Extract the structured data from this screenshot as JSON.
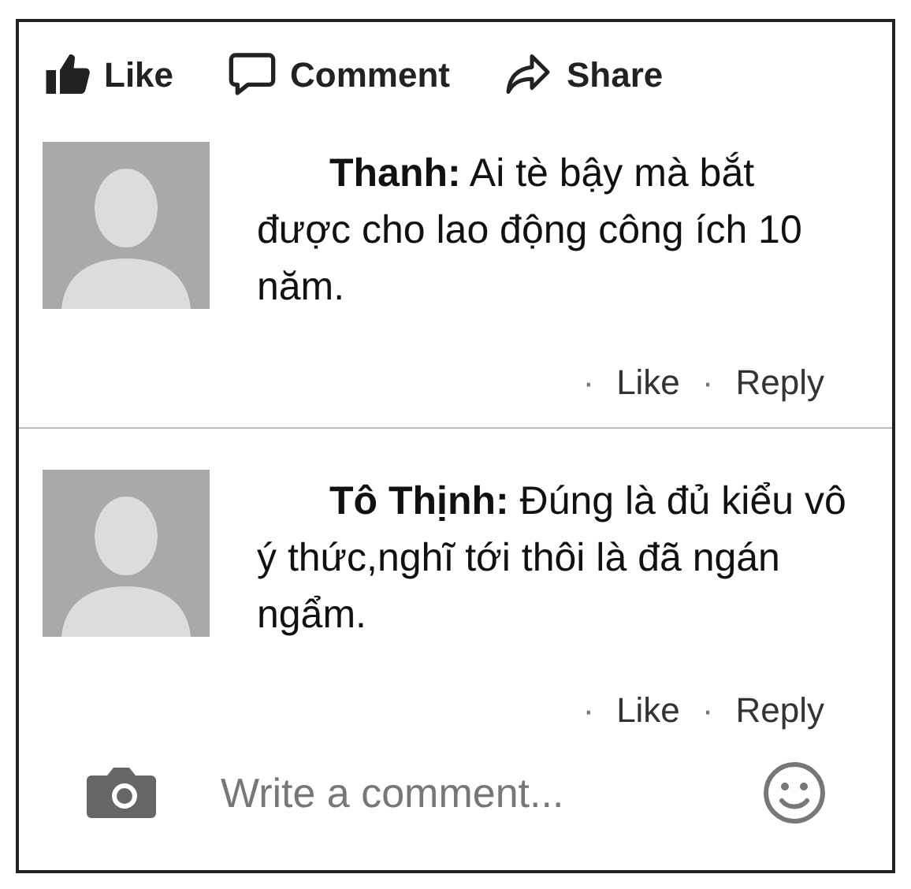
{
  "actions": [
    {
      "kind": "like",
      "label": "Like"
    },
    {
      "kind": "comment",
      "label": "Comment"
    },
    {
      "kind": "share",
      "label": "Share"
    }
  ],
  "comments": [
    {
      "text": "**Thanh:** Ai tè bậy mà bắt được cho lao động công ích 10 năm.",
      "actions": [
        {
          "bullet": "·",
          "label": "Like"
        },
        {
          "bullet": "·",
          "label": "Reply"
        }
      ]
    },
    {
      "text": "**Tô Thịnh:** Đúng là đủ kiểu vô ý thức,nghĩ tới thôi là đã ngán ngẩm.",
      "actions": [
        {
          "bullet": "·",
          "label": "Like"
        },
        {
          "bullet": "·",
          "label": "Reply"
        }
      ]
    }
  ],
  "composer": {
    "placeholder": "Write a comment..."
  }
}
